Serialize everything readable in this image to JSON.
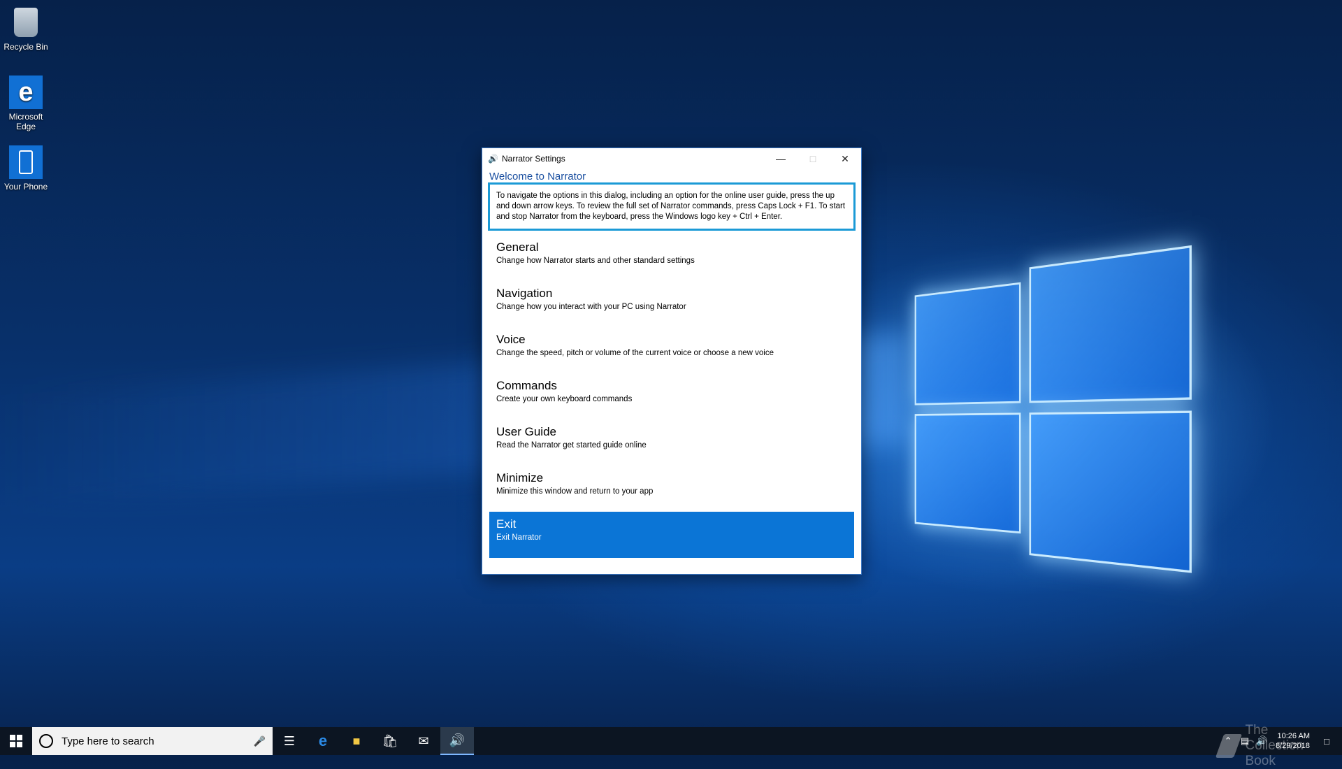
{
  "desktop": {
    "icons": [
      {
        "label": "Recycle Bin",
        "icon": "recycle-bin-icon"
      },
      {
        "label": "Microsoft Edge",
        "icon": "edge-icon"
      },
      {
        "label": "Your Phone",
        "icon": "phone-icon"
      }
    ]
  },
  "dialog": {
    "title": "Narrator Settings",
    "app_icon": "narrator-icon",
    "welcome": "Welcome to Narrator",
    "instructions": "To navigate the options in this dialog, including an option for the online user guide, press the up and down arrow keys. To review the full set of Narrator commands, press Caps Lock + F1. To start and stop Narrator from the keyboard, press the Windows logo key + Ctrl + Enter.",
    "menu": [
      {
        "title": "General",
        "desc": "Change how Narrator starts and other standard settings"
      },
      {
        "title": "Navigation",
        "desc": "Change how you interact with your PC using Narrator"
      },
      {
        "title": "Voice",
        "desc": "Change the speed, pitch or volume of the current voice or choose a new voice"
      },
      {
        "title": "Commands",
        "desc": "Create your own keyboard commands"
      },
      {
        "title": "User Guide",
        "desc": "Read the Narrator get started guide online"
      },
      {
        "title": "Minimize",
        "desc": "Minimize this window and return to your app"
      },
      {
        "title": "Exit",
        "desc": "Exit Narrator",
        "selected": true
      }
    ],
    "accent": "#0b75d6",
    "focus_border": "#1b9ad6"
  },
  "taskbar": {
    "search_placeholder": "Type here to search",
    "apps": [
      "task-view-icon",
      "edge-icon",
      "file-explorer-icon",
      "store-icon",
      "mail-icon",
      "narrator-icon"
    ],
    "time": "10:26 AM",
    "date": "8/29/2018",
    "watermark": "The Collection Book"
  }
}
